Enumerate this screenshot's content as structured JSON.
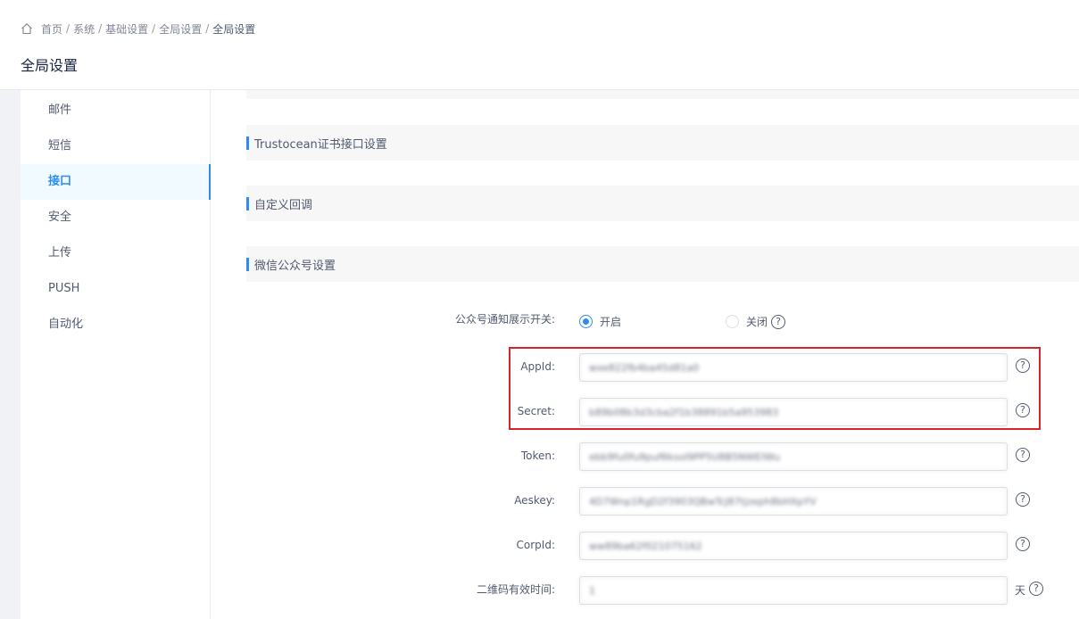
{
  "breadcrumb": {
    "items": [
      "首页",
      "系统",
      "基础设置",
      "全局设置",
      "全局设置"
    ],
    "separator": "/"
  },
  "page_title": "全局设置",
  "menu": {
    "items": [
      "邮件",
      "短信",
      "接口",
      "安全",
      "上传",
      "PUSH",
      "自动化"
    ],
    "active": "接口"
  },
  "sections": {
    "trustocean": "Trustocean证书接口设置",
    "callback": "自定义回调",
    "wechat": "微信公众号设置"
  },
  "form": {
    "notify_switch": {
      "label": "公众号通知展示开关:",
      "on_label": "开启",
      "off_label": "关闭"
    },
    "appid": {
      "label": "AppId:",
      "value": "wxe822fb4ba45d81a0"
    },
    "secret": {
      "label": "Secret:",
      "value": "b89b08b3d3cba2f1b38891b5a953983"
    },
    "token": {
      "label": "Token:",
      "value": "ebb9fu0fu9puf6ksoI9PP5U8B5NWEIWu"
    },
    "aeskey": {
      "label": "Aeskey:",
      "value": "4D7Wnp1RgD2f3903QBwTcJ87tjzeph8bHXpYV"
    },
    "corpid": {
      "label": "CorpId:",
      "value": "ww89ba62f021075162"
    },
    "qrcode_valid": {
      "label": "二维码有效时间:",
      "value": "1",
      "unit": "天"
    }
  },
  "icons": {
    "home": "home-icon",
    "help": "question-circle-icon",
    "help_glyph": "?"
  },
  "colors": {
    "accent": "#2d8cf0",
    "highlight": "#d9222a"
  }
}
